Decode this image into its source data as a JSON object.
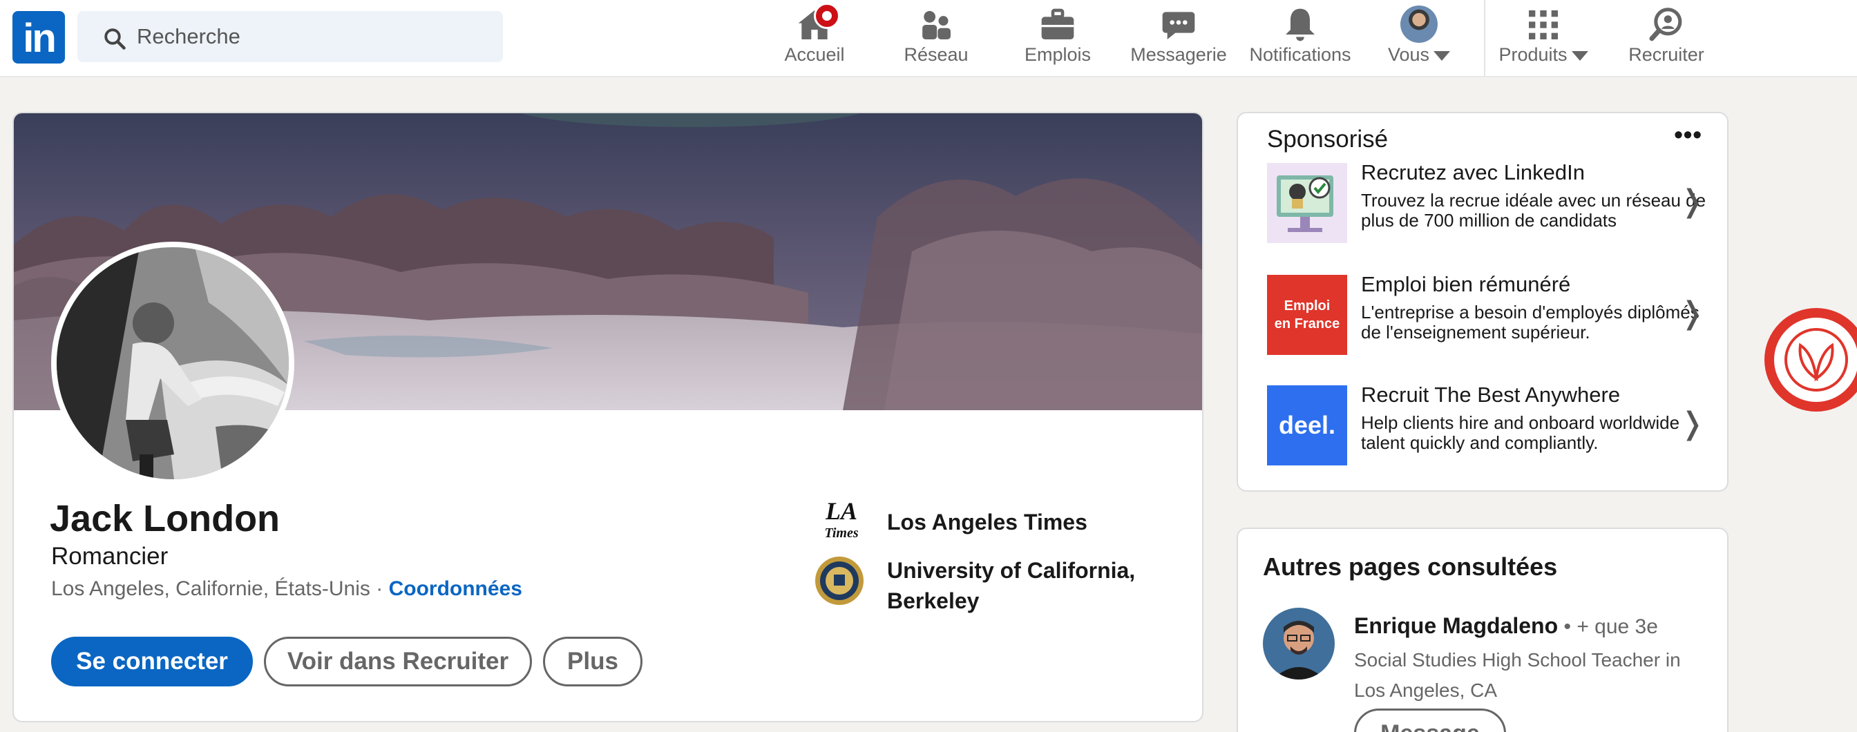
{
  "nav": {
    "logo": "in",
    "search_placeholder": "Recherche",
    "items": [
      {
        "label": "Accueil"
      },
      {
        "label": "Réseau"
      },
      {
        "label": "Emplois"
      },
      {
        "label": "Messagerie"
      },
      {
        "label": "Notifications"
      },
      {
        "label": "Vous"
      },
      {
        "label": "Produits"
      },
      {
        "label": "Recruiter"
      }
    ]
  },
  "profile": {
    "name": "Jack London",
    "headline": "Romancier",
    "location": "Los Angeles, Californie, États-Unis",
    "separator": " · ",
    "contact_link": "Coordonnées",
    "buttons": {
      "connect": "Se connecter",
      "recruiter": "Voir dans Recruiter",
      "more": "Plus"
    },
    "orgs": [
      {
        "logo_text": "LA Times",
        "name": "Los Angeles Times"
      },
      {
        "name_line1": "University of California,",
        "name_line2": "Berkeley"
      }
    ]
  },
  "sponsored": {
    "title": "Sponsorisé",
    "menu": "•••",
    "ads": [
      {
        "title": "Recrutez avec LinkedIn",
        "desc": "Trouvez la recrue idéale avec un réseau de plus de 700 million de candidats"
      },
      {
        "title": "Emploi bien rémunéré",
        "desc": "L'entreprise a besoin d'employés diplômés de l'enseignement supérieur.",
        "logo_line1": "Emploi",
        "logo_line2": "en France"
      },
      {
        "title": "Recruit The Best Anywhere",
        "desc": "Help clients hire and onboard worldwide talent quickly and compliantly.",
        "logo_text": "deel."
      }
    ],
    "chevron": "❭"
  },
  "others": {
    "title": "Autres pages consultées",
    "person": {
      "name": "Enrique Magdaleno",
      "degree": " • + que 3e",
      "desc": "Social Studies High School Teacher in Los Angeles, CA",
      "button": "Message"
    }
  },
  "colors": {
    "brand": "#0a66c2",
    "notification_badge": "#cc1016",
    "ad_red": "#e0352b",
    "deel_blue": "#2e6ff0"
  },
  "icons": [
    "search-icon",
    "home-icon",
    "network-icon",
    "briefcase-icon",
    "messaging-icon",
    "bell-icon",
    "grid-icon",
    "recruiter-icon"
  ]
}
